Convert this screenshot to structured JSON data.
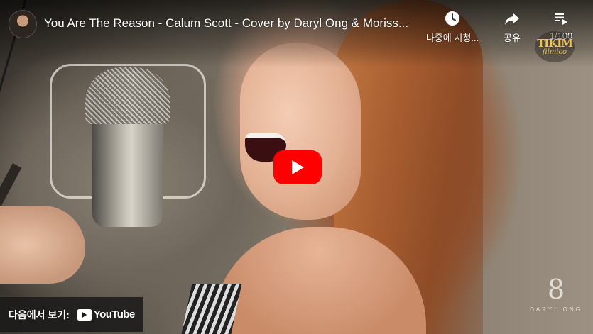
{
  "video": {
    "title": "You Are The Reason - Calum Scott - Cover by Daryl Ong & Moriss...",
    "channel_avatar_icon": "channel-avatar"
  },
  "top_actions": {
    "watch_later_label": "나중에 시청...",
    "watch_later_icon": "clock-icon",
    "share_label": "공유",
    "share_icon": "share-arrow-icon",
    "playlist_label": "1/100",
    "playlist_icon": "playlist-icon"
  },
  "watermarks": {
    "tikim_line1": "TIKIM",
    "tikim_line2": "filmico",
    "daryl_mark": "8",
    "daryl_text": "DARYL ONG"
  },
  "play_button": {
    "icon": "play-icon",
    "color": "#ff0000"
  },
  "watch_on": {
    "label": "다음에서 보기:",
    "brand": "YouTube"
  }
}
